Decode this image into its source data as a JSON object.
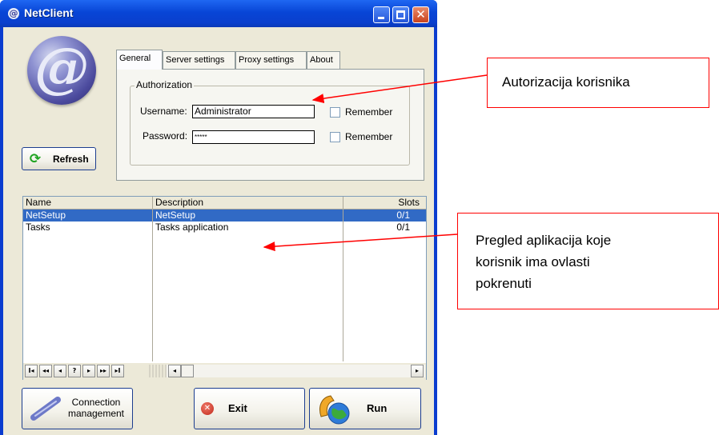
{
  "window": {
    "title": "NetClient"
  },
  "buttons": {
    "refresh": "Refresh",
    "connection": "Connection management",
    "exit": "Exit",
    "run": "Run"
  },
  "tabs": [
    {
      "label": "General"
    },
    {
      "label": "Server settings"
    },
    {
      "label": "Proxy settings"
    },
    {
      "label": "About"
    }
  ],
  "authorization": {
    "title": "Authorization",
    "username_label": "Username:",
    "username_value": "Administrator",
    "password_label": "Password:",
    "password_value": "*****",
    "remember_label": "Remember"
  },
  "table": {
    "columns": [
      "Name",
      "Description",
      "Slots"
    ],
    "rows": [
      {
        "name": "NetSetup",
        "description": "NetSetup",
        "slots": "0/1",
        "selected": true
      },
      {
        "name": "Tasks",
        "description": "Tasks application",
        "slots": "0/1",
        "selected": false
      }
    ]
  },
  "navigator": {
    "buttons": [
      "I◂",
      "◂◂",
      "◂",
      "?",
      "▸",
      "▸▸",
      "▸I"
    ]
  },
  "annotations": {
    "auth": "Autorizacija korisnika",
    "apps_line1": "Pregled aplikacija koje",
    "apps_line2": "korisnik ima ovlasti",
    "apps_line3": "pokrenuti"
  },
  "colors": {
    "titlebar": "#0a45d6",
    "selection": "#316ac5",
    "annotation": "#ff0000"
  }
}
